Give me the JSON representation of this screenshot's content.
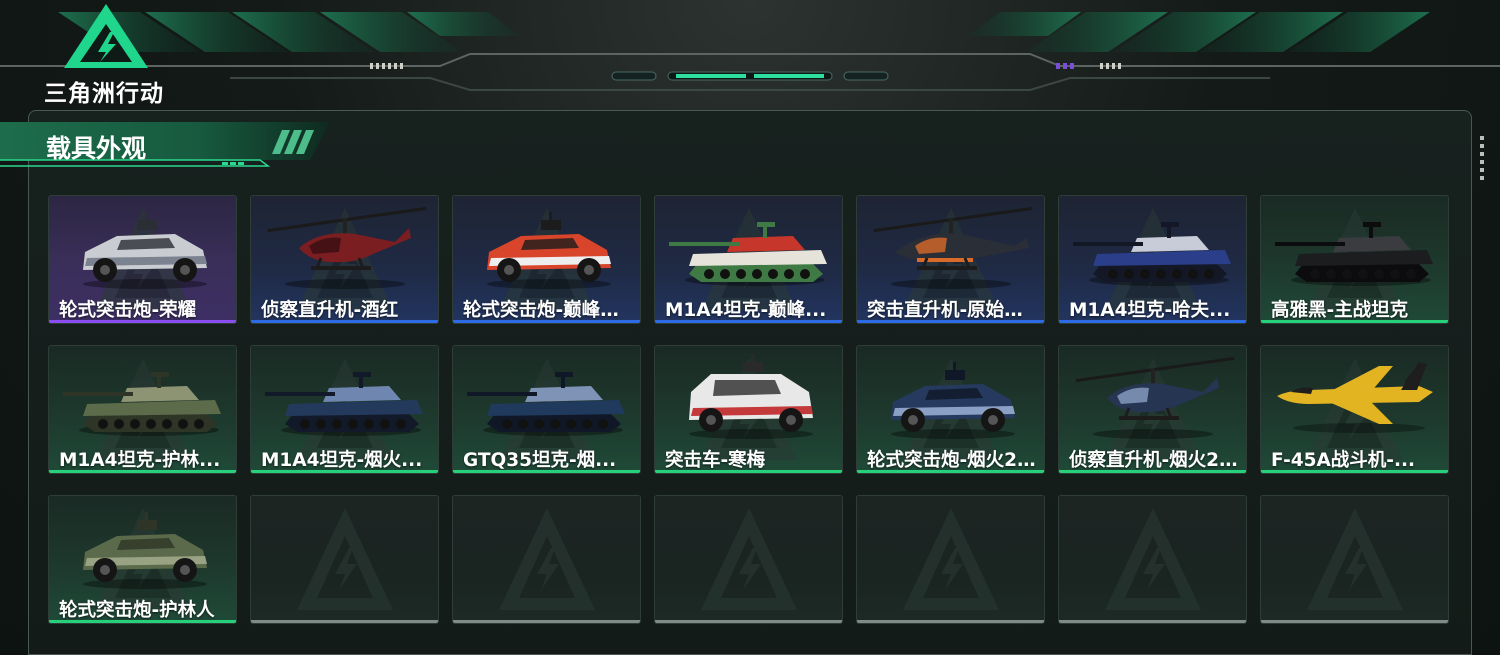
{
  "header": {
    "logo_text": "三角洲行动"
  },
  "section": {
    "title": "载具外观"
  },
  "colors": {
    "accent": "#26d17a",
    "rarity_purple": "#8a4df0",
    "rarity_blue": "#2d6be6",
    "rarity_green": "#26d17a",
    "empty_bar": "#808a86"
  },
  "cards": [
    {
      "label": "轮式突击炮-荣耀",
      "rarity": "purple",
      "vehicle": "wheeled-assault-gun-icon"
    },
    {
      "label": "侦察直升机-酒红",
      "rarity": "blue",
      "vehicle": "scout-helicopter-icon"
    },
    {
      "label": "轮式突击炮-巅峰竞...",
      "rarity": "blue",
      "vehicle": "wheeled-assault-gun-icon"
    },
    {
      "label": "M1A4坦克-巅峰...",
      "rarity": "blue",
      "vehicle": "tank-icon"
    },
    {
      "label": "突击直升机-原始伪...",
      "rarity": "blue",
      "vehicle": "attack-helicopter-icon"
    },
    {
      "label": "M1A4坦克-哈夫...",
      "rarity": "blue",
      "vehicle": "tank-icon"
    },
    {
      "label": "高雅黑-主战坦克",
      "rarity": "green",
      "vehicle": "tank-icon"
    },
    {
      "label": "M1A4坦克-护林...",
      "rarity": "green",
      "vehicle": "tank-icon"
    },
    {
      "label": "M1A4坦克-烟火...",
      "rarity": "green",
      "vehicle": "tank-icon"
    },
    {
      "label": "GTQ35坦克-烟...",
      "rarity": "green",
      "vehicle": "tank-icon"
    },
    {
      "label": "突击车-寒梅",
      "rarity": "green",
      "vehicle": "assault-vehicle-icon"
    },
    {
      "label": "轮式突击炮-烟火2...",
      "rarity": "green",
      "vehicle": "wheeled-assault-gun-icon"
    },
    {
      "label": "侦察直升机-烟火2...",
      "rarity": "green",
      "vehicle": "scout-helicopter-icon"
    },
    {
      "label": "F-45A战斗机-...",
      "rarity": "green",
      "vehicle": "fighter-jet-icon"
    },
    {
      "label": "轮式突击炮-护林人",
      "rarity": "green",
      "vehicle": "wheeled-assault-gun-icon"
    },
    {
      "label": "",
      "rarity": "empty",
      "vehicle": ""
    },
    {
      "label": "",
      "rarity": "empty",
      "vehicle": ""
    },
    {
      "label": "",
      "rarity": "empty",
      "vehicle": ""
    },
    {
      "label": "",
      "rarity": "empty",
      "vehicle": ""
    },
    {
      "label": "",
      "rarity": "empty",
      "vehicle": ""
    },
    {
      "label": "",
      "rarity": "empty",
      "vehicle": ""
    }
  ]
}
